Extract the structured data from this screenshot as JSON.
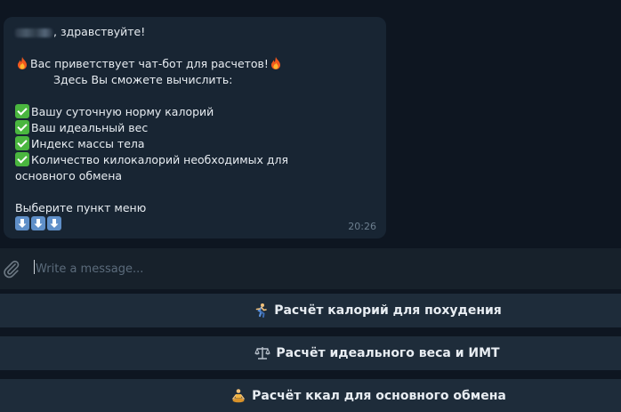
{
  "message": {
    "greeting": "здравствуйте!",
    "welcome": "Вас приветствует чат-бот для расчетов!",
    "intro": "Здесь Вы сможете вычислить:",
    "items": [
      "Вашу суточную норму калорий",
      "Ваш идеальный вес",
      "Индекс массы тела",
      "Количество килокалорий необходимых для основного обмена"
    ],
    "prompt": "Выберите пункт меню",
    "time": "20:26"
  },
  "composer": {
    "placeholder": "Write a message..."
  },
  "keyboard": {
    "buttons": [
      {
        "label": "Расчёт калорий для похудения",
        "icon": "runner-icon"
      },
      {
        "label": "Расчёт идеального веса и ИМТ",
        "icon": "scales-icon"
      },
      {
        "label": "Расчёт ккал для основного обмена",
        "icon": "meditation-icon"
      }
    ]
  },
  "colors": {
    "background": "#0e1621",
    "bubble": "#182533",
    "keyboard_button": "#1e2c3a",
    "composer": "#17212b"
  }
}
